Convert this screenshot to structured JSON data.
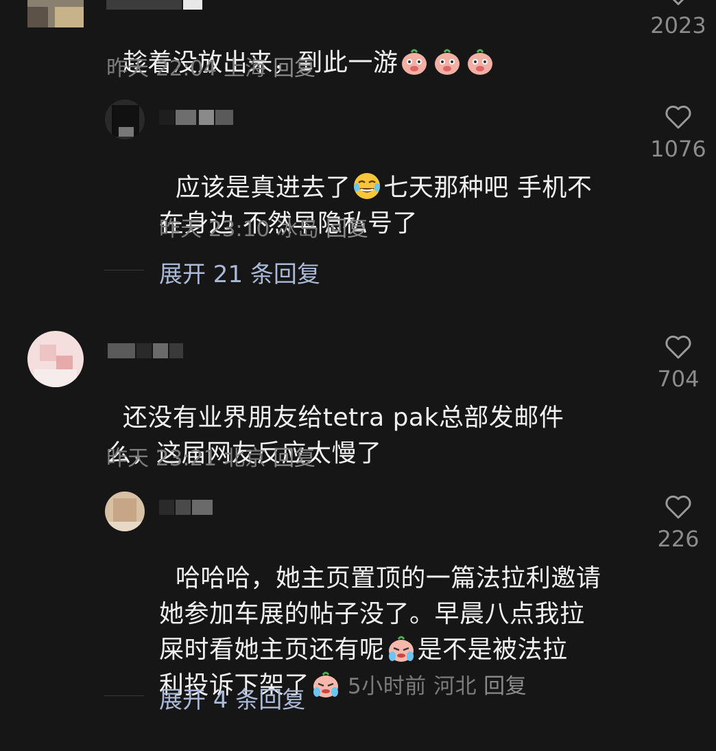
{
  "comments": [
    {
      "text": "趁着没放出来，到此一游",
      "time": "昨天 22:04",
      "location": "上海",
      "reply_label": "回复",
      "likes": "2023",
      "emoji": "peach-face-covering-mouth"
    },
    {
      "text": "应该是真进去了😂七天那种吧 手机不在身边 不然早隐私号了",
      "text_parts": [
        "应该是真进去了",
        "七天那种吧 手机不",
        "在身边 不然早隐私号了"
      ],
      "time": "昨天 23:10",
      "location": "冰岛",
      "reply_label": "回复",
      "likes": "1076"
    },
    {
      "text_parts": [
        "还没有业界朋友给tetra pak总部发邮件",
        "么，这届网友反应太慢了"
      ],
      "time": "昨天 23:21",
      "location": "北京",
      "reply_label": "回复",
      "likes": "704"
    },
    {
      "text_parts": [
        "哈哈哈，她主页置顶的一篇法拉利邀请",
        "她参加车展的帖子没了。早晨八点我拉",
        "屎时看她主页还有呢",
        "是不是被法拉",
        "利投诉下架了"
      ],
      "time": "5小时前",
      "location": "河北",
      "reply_label": "回复",
      "likes": "226"
    }
  ],
  "expand_1": "展开 21 条回复",
  "expand_2": "展开 4 条回复",
  "colors": {
    "background": "#161616",
    "text": "#f0f0f0",
    "meta": "#7c7c7c",
    "expand": "#a9b9d6"
  }
}
